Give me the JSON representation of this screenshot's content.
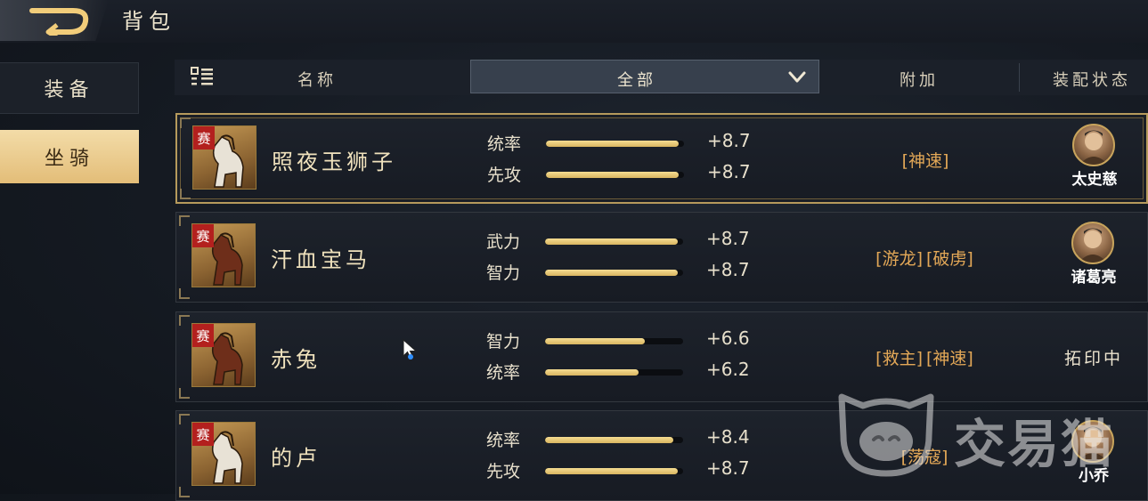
{
  "header": {
    "title": "背包"
  },
  "tabs": [
    {
      "label": "装备",
      "active": false
    },
    {
      "label": "坐骑",
      "active": true
    }
  ],
  "columns": {
    "name": "名称",
    "filter_selected": "全部",
    "extra": "附加",
    "status": "装配状态"
  },
  "mounts": [
    {
      "seal": "赛",
      "name": "照夜玉狮子",
      "selected": true,
      "stats": [
        {
          "label": "统率",
          "value": "+8.7",
          "fill_pct": 96
        },
        {
          "label": "先攻",
          "value": "+8.7",
          "fill_pct": 96
        }
      ],
      "tags": [
        "[神速]"
      ],
      "status": {
        "hero": "太史慈"
      }
    },
    {
      "seal": "赛",
      "name": "汗血宝马",
      "selected": false,
      "stats": [
        {
          "label": "武力",
          "value": "+8.7",
          "fill_pct": 96
        },
        {
          "label": "智力",
          "value": "+8.7",
          "fill_pct": 96
        }
      ],
      "tags": [
        "[游龙]",
        "[破虏]"
      ],
      "status": {
        "hero": "诸葛亮"
      }
    },
    {
      "seal": "赛",
      "name": "赤兔",
      "selected": false,
      "stats": [
        {
          "label": "智力",
          "value": "+6.6",
          "fill_pct": 72
        },
        {
          "label": "统率",
          "value": "+6.2",
          "fill_pct": 68
        }
      ],
      "tags": [
        "[救主]",
        "[神速]"
      ],
      "status": {
        "text": "拓印中"
      }
    },
    {
      "seal": "赛",
      "name": "的卢",
      "selected": false,
      "stats": [
        {
          "label": "统率",
          "value": "+8.4",
          "fill_pct": 93
        },
        {
          "label": "先攻",
          "value": "+8.7",
          "fill_pct": 96
        }
      ],
      "tags": [
        "[荡寇]"
      ],
      "status": {
        "hero": "小乔"
      }
    }
  ],
  "watermark": {
    "text": "交易猫"
  },
  "colors": {
    "accent_gold": "#e3bd78",
    "tag": "#e3a857",
    "seal_red": "#b3201e"
  }
}
